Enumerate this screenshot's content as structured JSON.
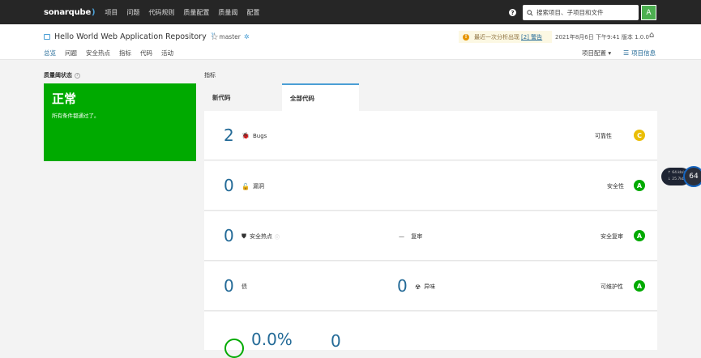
{
  "topbar": {
    "logo": "sonarqube",
    "nav": [
      "项目",
      "问题",
      "代码规则",
      "质量配置",
      "质量阈",
      "配置"
    ],
    "help": "?",
    "search_placeholder": "搜索项目、子项目和文件",
    "avatar": "A"
  },
  "project": {
    "name": "Hello World Web Application Repository",
    "branch": "master",
    "warning_text": "最近一次分析出现",
    "warning_link": "[2] 警告",
    "analysis_date": "2021年8月6日 下午9:41",
    "version": "版本 1.0.0",
    "subnav": [
      "总览",
      "问题",
      "安全热点",
      "指标",
      "代码",
      "活动"
    ],
    "config": "项目配置 ▾",
    "info": "项目信息"
  },
  "quality_gate": {
    "label": "质量阈状态",
    "status": "正常",
    "message": "所有条件都通过了。"
  },
  "metrics": {
    "label": "指标",
    "tabs": [
      "新代码",
      "全部代码"
    ],
    "bugs": {
      "value": "2",
      "label": "Bugs",
      "rating_label": "可靠性",
      "rating": "C"
    },
    "vulnerabilities": {
      "value": "0",
      "label": "漏洞",
      "rating_label": "安全性",
      "rating": "A"
    },
    "hotspots": {
      "value": "0",
      "label": "安全热点",
      "review_value": "—",
      "review_label": "复审",
      "rating_label": "安全复审",
      "rating": "A"
    },
    "debt": {
      "value": "0",
      "label": "债",
      "smells_value": "0",
      "smells_label": "异味",
      "rating_label": "可维护性",
      "rating": "A"
    },
    "coverage": {
      "value": "0.0%",
      "duplications": "0"
    }
  },
  "widget": {
    "line1": "↑ 64.kb/s",
    "line2": "↓ 25.7kb/s",
    "dial": "64"
  },
  "colors": {
    "topbar": "#262626",
    "passed": "#00aa00",
    "link": "#236a97",
    "rating_a": "#00aa00",
    "rating_c": "#eabe06"
  }
}
